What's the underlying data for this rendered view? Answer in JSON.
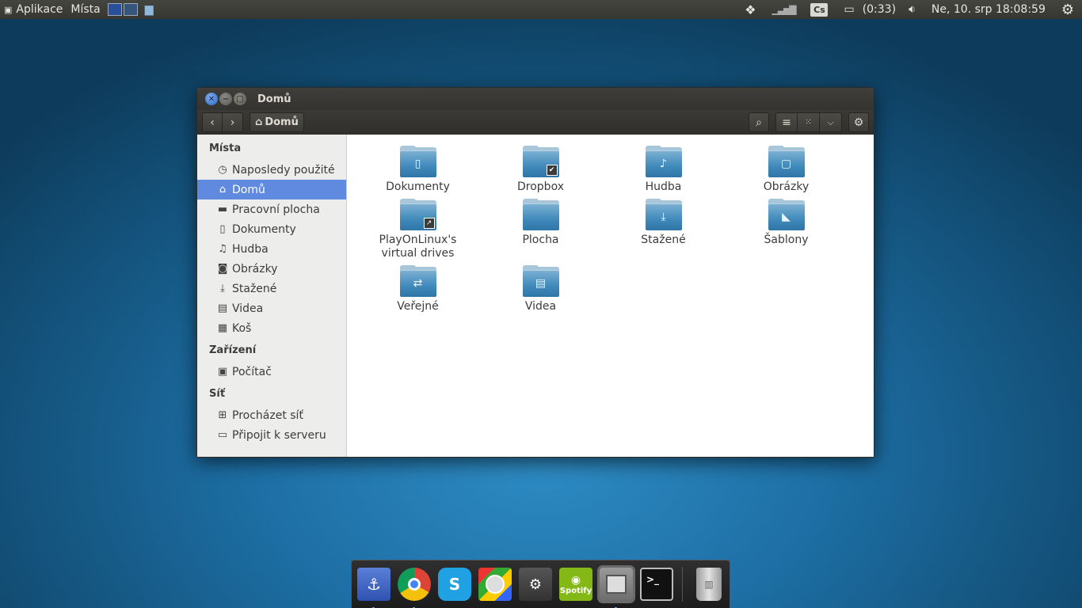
{
  "topbar": {
    "apps_label": "Aplikace",
    "places_label": "Místa",
    "keyboard_layout": "Cs",
    "battery_time": "(0:33)",
    "clock": "Ne, 10. srp 18:08:59"
  },
  "window": {
    "title": "Domů",
    "breadcrumb": "Domů"
  },
  "sidebar": {
    "places_header": "Místa",
    "places": [
      {
        "label": "Naposledy použité",
        "icon": "clock-icon"
      },
      {
        "label": "Domů",
        "icon": "home-icon",
        "active": true
      },
      {
        "label": "Pracovní plocha",
        "icon": "desktop-icon"
      },
      {
        "label": "Dokumenty",
        "icon": "document-icon"
      },
      {
        "label": "Hudba",
        "icon": "music-icon"
      },
      {
        "label": "Obrázky",
        "icon": "camera-icon"
      },
      {
        "label": "Stažené",
        "icon": "download-icon"
      },
      {
        "label": "Videa",
        "icon": "film-icon"
      },
      {
        "label": "Koš",
        "icon": "trash-icon"
      }
    ],
    "devices_header": "Zařízení",
    "devices": [
      {
        "label": "Počítač",
        "icon": "computer-icon"
      }
    ],
    "network_header": "Síť",
    "network": [
      {
        "label": "Procházet síť",
        "icon": "network-icon"
      },
      {
        "label": "Připojit k serveru",
        "icon": "server-icon"
      }
    ]
  },
  "files": [
    {
      "name": "Dokumenty",
      "emblem": "document-icon"
    },
    {
      "name": "Dropbox",
      "emblem": "check-icon"
    },
    {
      "name": "Hudba",
      "emblem": "music-note-icon"
    },
    {
      "name": "Obrázky",
      "emblem": "picture-icon"
    },
    {
      "name": "PlayOnLinux's virtual drives",
      "emblem": "link-arrow-icon"
    },
    {
      "name": "Plocha",
      "emblem": ""
    },
    {
      "name": "Stažené",
      "emblem": "download-icon"
    },
    {
      "name": "Šablony",
      "emblem": "template-icon"
    },
    {
      "name": "Veřejné",
      "emblem": "share-icon"
    },
    {
      "name": "Videa",
      "emblem": "film-icon"
    }
  ],
  "dock": {
    "items": [
      "anchor-launcher",
      "chrome",
      "skype",
      "search-app",
      "steam",
      "spotify",
      "file-manager",
      "terminal",
      "trash"
    ],
    "spotify_label": "Spotify"
  },
  "colors": {
    "accent": "#5f8ae0",
    "folder": "#3f89bb",
    "panel": "#3c3b37"
  }
}
